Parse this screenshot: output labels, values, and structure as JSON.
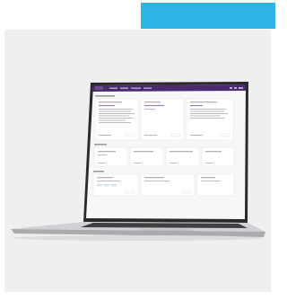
{
  "colors": {
    "banner": "#2db3e6",
    "panel": "#efefef",
    "app_header": "#4b2a6e",
    "laptop_body": "#cfd1d4"
  },
  "app": {
    "logo": "",
    "section_1_title": "",
    "section_2_title": "",
    "section_3_title": ""
  }
}
